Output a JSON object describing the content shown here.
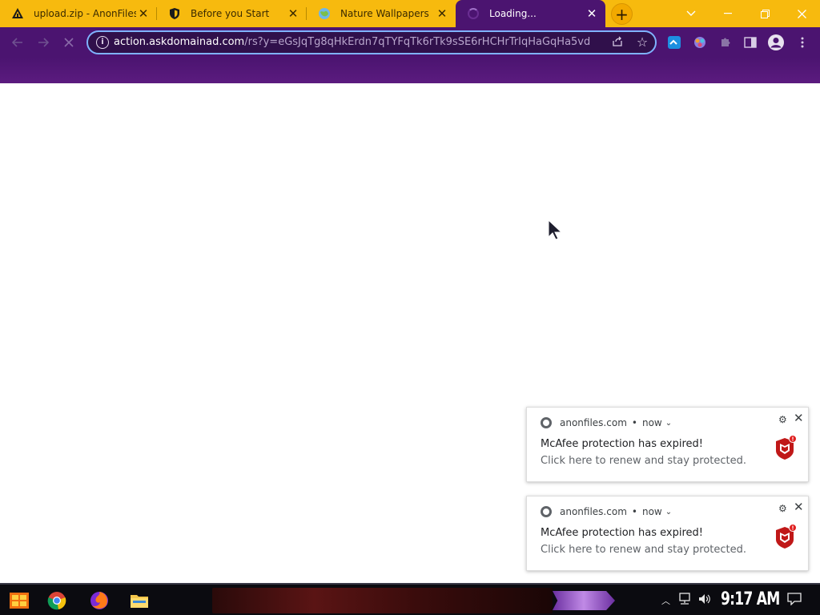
{
  "browser": {
    "tabs": [
      {
        "title": "upload.zip - AnonFiles",
        "favicon": "anonfiles-icon",
        "active": false
      },
      {
        "title": "Before you Start",
        "favicon": "shield-icon",
        "active": false
      },
      {
        "title": "Nature Wallpapers",
        "favicon": "globe-icon",
        "active": false
      },
      {
        "title": "Loading...",
        "favicon": "loading-spinner-icon",
        "active": true
      }
    ],
    "new_tab_label": "+",
    "url_host": "action.askdomainad.com",
    "url_path": "/rs?y=eGsJqTg8qHkErdn7qTYFqTk6rTk9sSE6rHCHrTrIqHaGqHa5vd"
  },
  "notifications": [
    {
      "origin": "anonfiles.com",
      "separator": "•",
      "time": "now",
      "title": "McAfee protection has expired!",
      "message": "Click here to renew and stay protected."
    },
    {
      "origin": "anonfiles.com",
      "separator": "•",
      "time": "now",
      "title": "McAfee protection has expired!",
      "message": "Click here to renew and stay protected."
    }
  ],
  "taskbar": {
    "clock": "9:17 AM"
  },
  "colors": {
    "tabstrip": "#f7ba0e",
    "toolbar": "#4b1470",
    "omnibox_focus": "#7fb3ff",
    "mcafee_red": "#c01818"
  }
}
